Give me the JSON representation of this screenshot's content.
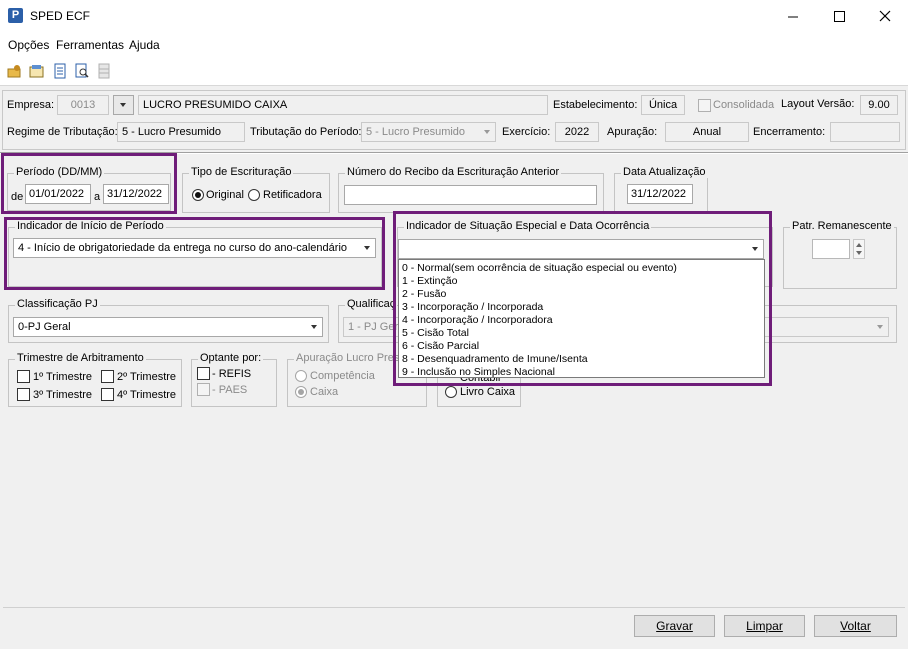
{
  "window": {
    "app_icon": "P",
    "title": "SPED ECF",
    "controls": [
      "minimize-icon",
      "maximize-icon",
      "close-icon"
    ]
  },
  "menu": [
    "Opções",
    "Ferramentas",
    "Ajuda"
  ],
  "toolbar": {
    "icons": [
      "open-folder-icon",
      "properties-icon",
      "document-icon",
      "search-document-icon",
      "disabled-grid-icon"
    ]
  },
  "header": {
    "empresa_label": "Empresa:",
    "empresa_code": "0013",
    "empresa_name": "LUCRO PRESUMIDO CAIXA",
    "estabelecimento_label": "Estabelecimento:",
    "estabelecimento_value": "Única",
    "consolidada_label": "Consolidada",
    "layout_label": "Layout Versão:",
    "layout_value": "9.00",
    "regime_label": "Regime de Tributação:",
    "regime_value": "5 - Lucro Presumido",
    "trib_periodo_label": "Tributação do Período:",
    "trib_periodo_value": "5 - Lucro Presumido",
    "exercicio_label": "Exercício:",
    "exercicio_value": "2022",
    "apuracao_label": "Apuração:",
    "apuracao_value": "Anual",
    "encerramento_label": "Encerramento:",
    "encerramento_value": ""
  },
  "periodo": {
    "title": "Período (DD/MM)",
    "de_label": "de",
    "start": "01/01/2022",
    "a_label": "a",
    "end": "31/12/2022"
  },
  "escrituracao": {
    "title": "Tipo de Escrituração",
    "original": "Original",
    "retificadora": "Retificadora"
  },
  "recibo": {
    "title": "Número do Recibo da Escrituração Anterior",
    "value": ""
  },
  "data_atualizacao": {
    "title": "Data Atualização",
    "value": "31/12/2022"
  },
  "inicio_periodo": {
    "title": "Indicador de Início de Período",
    "value": "4 - Início de obrigatoriedade da entrega no curso do ano-calendário"
  },
  "situacao_especial": {
    "title": "Indicador de Situação Especial e Data Ocorrência",
    "value": "",
    "options": [
      "0 - Normal(sem ocorrência de situação especial ou evento)",
      "1 - Extinção",
      "2 - Fusão",
      "3 - Incorporação / Incorporada",
      "4 - Incorporação / Incorporadora",
      "5 - Cisão Total",
      "6 - Cisão Parcial",
      "8 - Desenquadramento de Imune/Isenta",
      "9 - Inclusão no Simples Nacional"
    ]
  },
  "patr_remanescente": {
    "title": "Patr. Remanescente",
    "value": ""
  },
  "classificacao_pj": {
    "title": "Classificação PJ",
    "value": "0-PJ Geral"
  },
  "qualificacao": {
    "title": "Qualificaç",
    "value": "1 - PJ Gera"
  },
  "trimestre": {
    "title": "Trimestre de Arbitramento",
    "items": [
      "1º Trimestre",
      "2º Trimestre",
      "3º Trimestre",
      "4º Trimestre"
    ]
  },
  "optante": {
    "title": "Optante por:",
    "refis": "- REFIS",
    "paes": "- PAES"
  },
  "apuracao_lucro": {
    "title": "Apuração Lucro Pres",
    "competencia": "Competência",
    "caixa": "Caixa"
  },
  "livro": {
    "contabil": "Contábil",
    "livro_caixa": "Livro Caixa"
  },
  "buttons": {
    "gravar": "Gravar",
    "limpar": "Limpar",
    "voltar": "Voltar"
  },
  "colors": {
    "highlight": "#6f1d79",
    "background": "#f0f0f0"
  }
}
